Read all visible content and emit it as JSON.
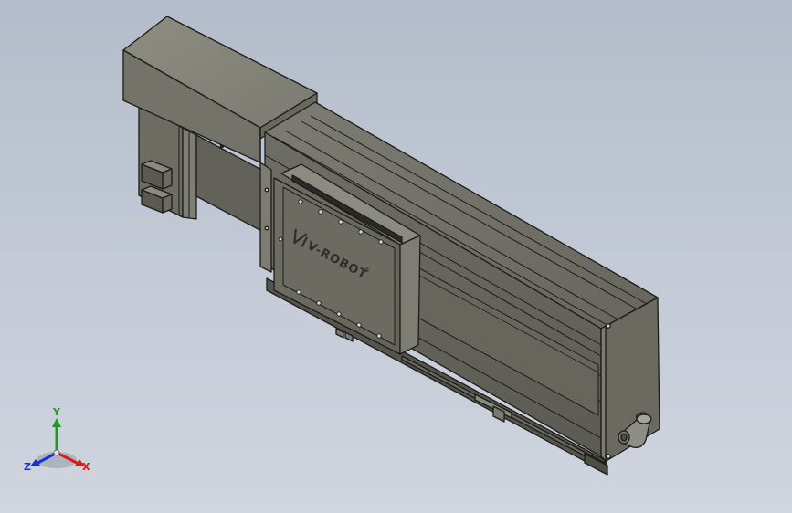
{
  "model": {
    "brand_label": "V-ROBOT",
    "registered_mark": "®"
  },
  "triad": {
    "x_label": "X",
    "y_label": "Y",
    "z_label": "Z",
    "x_color": "#e01818",
    "y_color": "#18a018",
    "z_color": "#1830d8"
  },
  "colors": {
    "body_dark": "#5e5e55",
    "body_mid": "#73736a",
    "body_light": "#8a8a80",
    "edge": "#1c1c1a",
    "background_top": "#b4bccb",
    "background_bottom": "#d0d5de"
  }
}
